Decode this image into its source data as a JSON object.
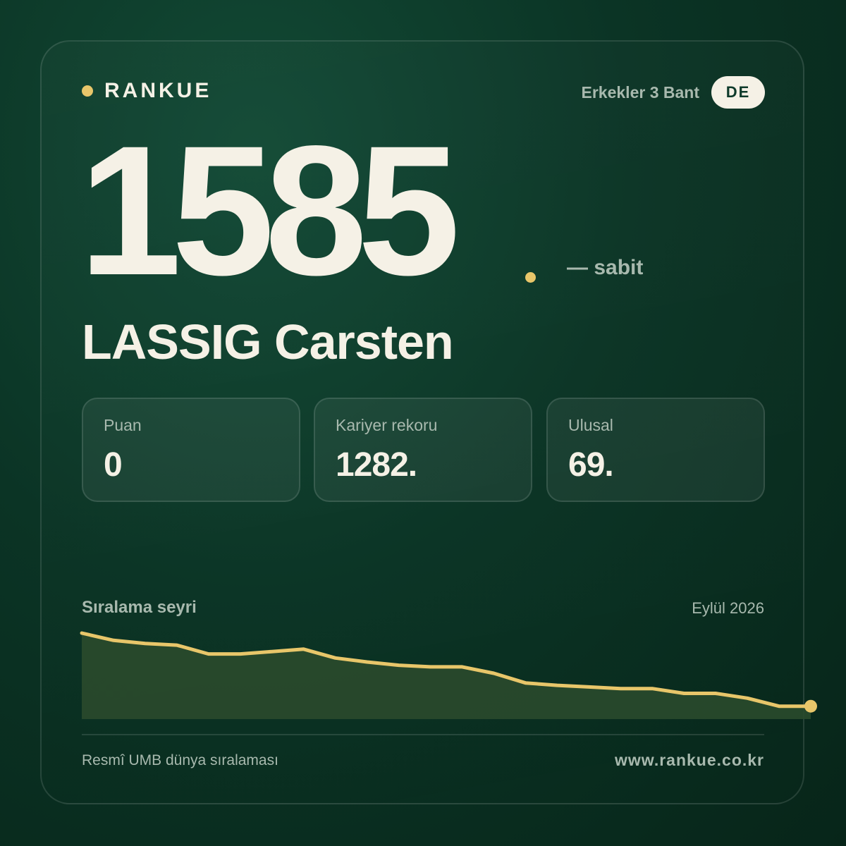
{
  "brand": {
    "name": "RANKUE"
  },
  "header": {
    "category": "Erkekler 3 Bant",
    "country": "DE"
  },
  "player": {
    "points": "1585",
    "trend": "— sabit",
    "name": "LASSIG Carsten"
  },
  "stats": [
    {
      "label": "Puan",
      "value": "0"
    },
    {
      "label": "Kariyer rekoru",
      "value": "1282."
    },
    {
      "label": "Ulusal",
      "value": "69."
    }
  ],
  "chart": {
    "title": "Sıralama seyri",
    "date": "Eylül 2026"
  },
  "chart_data": {
    "type": "area",
    "x": [
      1,
      2,
      3,
      4,
      5,
      6,
      7,
      8,
      9,
      10,
      11,
      12,
      13,
      14,
      15,
      16,
      17,
      18,
      19,
      20,
      21,
      22,
      23,
      24
    ],
    "y": [
      1,
      0.91,
      0.87,
      0.85,
      0.74,
      0.74,
      0.77,
      0.8,
      0.69,
      0.64,
      0.6,
      0.58,
      0.58,
      0.5,
      0.38,
      0.35,
      0.33,
      0.31,
      0.31,
      0.25,
      0.25,
      0.19,
      0.09,
      0.09
    ],
    "y_note": "relative trend level (no axis labels shown)",
    "line_color": "#e8c66a",
    "fill_color": "#2a4a2c"
  },
  "footer": {
    "source": "Resmî UMB dünya sıralaması",
    "url": "www.rankue.co.kr"
  },
  "colors": {
    "accent": "#e8c66a",
    "text": "#f5f1e6",
    "muted": "#a8b9ae"
  }
}
